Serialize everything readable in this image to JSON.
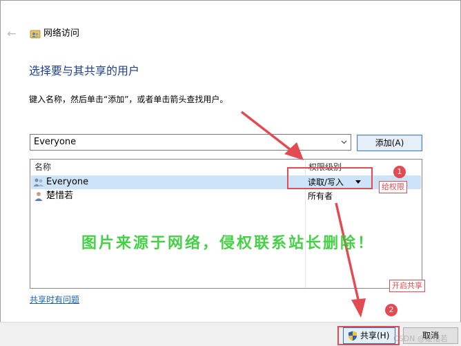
{
  "header": {
    "back_icon": "back-arrow-icon",
    "wizard_icon": "network-users-icon",
    "title": "网络访问"
  },
  "main": {
    "heading": "选择要与其共享的用户",
    "instruction": "键入名称，然后单击“添加”，或者单击箭头查找用户。",
    "combo_value": "Everyone",
    "add_button": "添加(A)",
    "columns": {
      "name": "名称",
      "permission": "权限级别"
    },
    "rows": [
      {
        "name": "Everyone",
        "permission": "读取/写入",
        "icon": "group-users-icon",
        "selected": true,
        "has_dropdown": true
      },
      {
        "name": "楚惜若",
        "permission": "所有者",
        "icon": "user-icon",
        "selected": false,
        "has_dropdown": false
      }
    ],
    "help_link": "共享时有问题"
  },
  "footer": {
    "share_button": "共享(H)",
    "share_icon": "uac-shield-icon",
    "cancel_button": "取消"
  },
  "annotations": {
    "step1": "1",
    "step1_label": "给权限",
    "step2": "2",
    "step2_label": "开启共享",
    "watermark": "图片来源于网络，侵权联系站长删除！",
    "csdn": "CSDN @楚惜若",
    "color": "#e24b52"
  }
}
